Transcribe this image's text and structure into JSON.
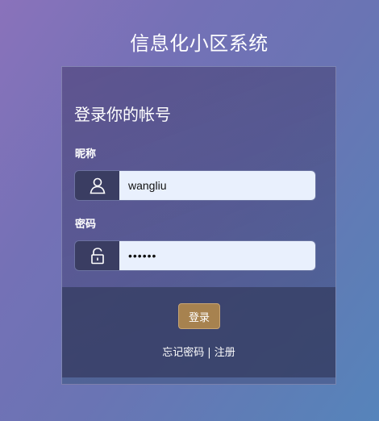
{
  "app_title": "信息化小区系统",
  "form": {
    "heading": "登录你的帐号",
    "username": {
      "label": "昵称",
      "value": "wangliu",
      "icon": "user-icon"
    },
    "password": {
      "label": "密码",
      "value": "••••••",
      "icon": "lock-icon"
    },
    "login_label": "登录"
  },
  "links": {
    "forgot_password": "忘记密码",
    "separator": "|",
    "register": "注册"
  },
  "colors": {
    "button": "#a7824f",
    "addon": "#3a3d62",
    "input_bg": "#e9f0fd"
  }
}
